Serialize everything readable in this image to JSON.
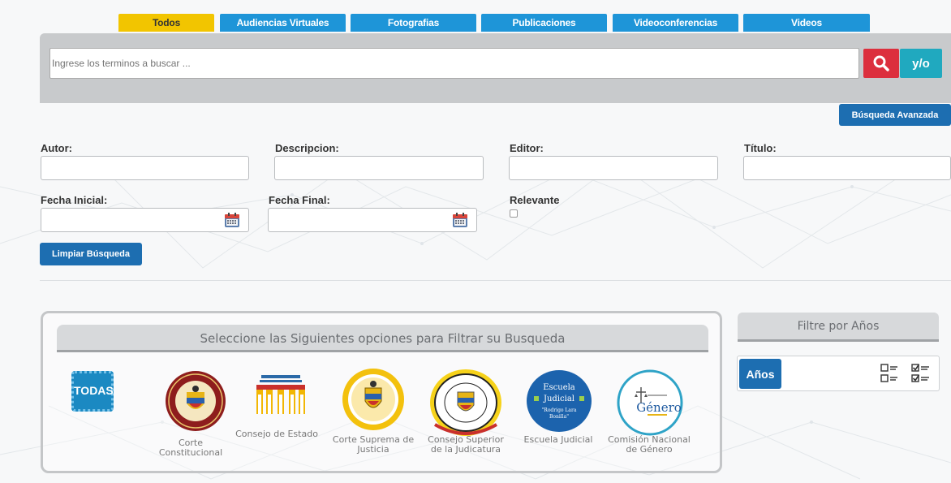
{
  "tabs": [
    {
      "label": "Todos",
      "active": true
    },
    {
      "label": "Audiencias Virtuales",
      "active": false
    },
    {
      "label": "Fotografias",
      "active": false
    },
    {
      "label": "Publicaciones",
      "active": false
    },
    {
      "label": "Videoconferencias",
      "active": false
    },
    {
      "label": "Videos",
      "active": false
    }
  ],
  "search": {
    "placeholder": "Ingrese los terminos a buscar ...",
    "search_icon": "search-icon",
    "yo_label": "y/o",
    "advanced_label": "Búsqueda Avanzada"
  },
  "form": {
    "autor_label": "Autor:",
    "descripcion_label": "Descripcion:",
    "editor_label": "Editor:",
    "titulo_label": "Título:",
    "fecha_inicial_label": "Fecha Inicial:",
    "fecha_final_label": "Fecha Final:",
    "relevante_label": "Relevante",
    "calendar_icon": "calendar-icon",
    "clear_label": "Limpiar Búsqueda"
  },
  "filter": {
    "title": "Seleccione las Siguientes opciones para Filtrar su Busqueda",
    "todas_label": "TODAS",
    "options": [
      {
        "label": "Corte Constitucional",
        "icon": "corte-constitucional-seal-icon"
      },
      {
        "label": "Consejo de Estado",
        "icon": "consejo-estado-building-icon"
      },
      {
        "label": "Corte Suprema de Justicia",
        "icon": "corte-suprema-seal-icon"
      },
      {
        "label": "Consejo Superior de la Judicatura",
        "icon": "rama-judicial-seal-icon"
      },
      {
        "label": "Escuela Judicial",
        "icon": "escuela-judicial-logo-icon",
        "logo_text": [
          "Escuela",
          "Judicial",
          "\"Rodrigo Lara",
          "Bonilla\""
        ]
      },
      {
        "label": "Comisión Nacional de Género",
        "icon": "comision-genero-logo-icon",
        "logo_text": "Género"
      }
    ]
  },
  "years": {
    "title": "Filtre por Años",
    "button_label": "Años",
    "list_icon": "list-unchecked-icon",
    "check_icon": "list-checked-icon"
  },
  "colors": {
    "tab_active": "#f2c500",
    "tab": "#1e95d8",
    "search_button": "#dc2f3d",
    "yo_button": "#20a9bf",
    "primary_button": "#1d6eb1",
    "panel_gray": "#c8cacc"
  }
}
